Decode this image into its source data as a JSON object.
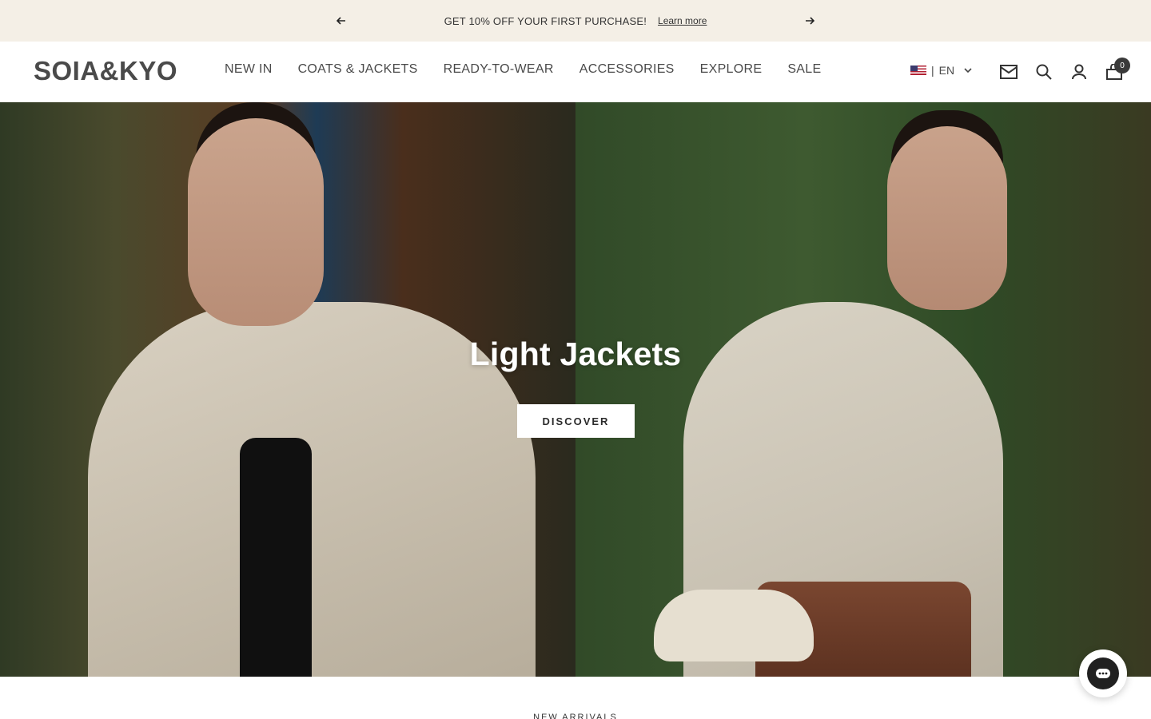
{
  "announcement": {
    "text": "GET 10% OFF YOUR FIRST PURCHASE!",
    "link_label": "Learn more",
    "prev_icon": "arrow-left-icon",
    "next_icon": "arrow-right-icon",
    "background_color": "#f4efe6"
  },
  "header": {
    "logo": "SOIA&KYO",
    "nav": [
      {
        "label": "NEW IN"
      },
      {
        "label": "COATS & JACKETS"
      },
      {
        "label": "READY-TO-WEAR"
      },
      {
        "label": "ACCESSORIES"
      },
      {
        "label": "EXPLORE"
      },
      {
        "label": "SALE"
      }
    ],
    "locale": {
      "separator": "|",
      "language": "EN",
      "flag_icon": "us-flag-icon",
      "chevron_icon": "chevron-down-icon"
    },
    "icons": {
      "newsletter": "mail-icon",
      "search": "search-icon",
      "account": "user-icon",
      "cart": "cart-icon"
    },
    "cart_count": "0"
  },
  "hero": {
    "title": "Light Jackets",
    "button_label": "DISCOVER"
  },
  "section": {
    "label": "NEW ARRIVALS"
  },
  "chat": {
    "icon": "chat-icon"
  }
}
